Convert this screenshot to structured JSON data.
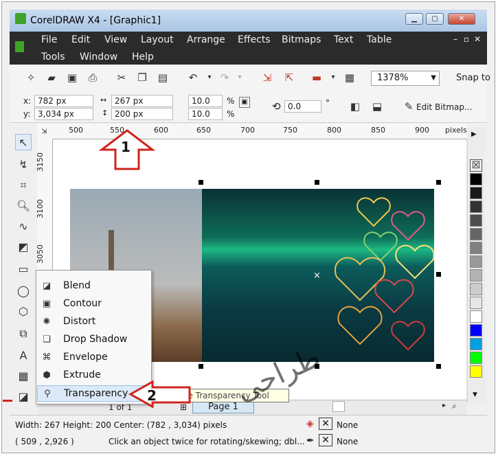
{
  "window": {
    "title": "CorelDRAW X4 - [Graphic1]"
  },
  "menu": {
    "row1": [
      "File",
      "Edit",
      "View",
      "Layout",
      "Arrange",
      "Effects",
      "Bitmaps",
      "Text",
      "Table"
    ],
    "row2": [
      "Tools",
      "Window",
      "Help"
    ],
    "mdi_controls": [
      "–",
      "▫",
      "✕"
    ]
  },
  "toolbar": {
    "zoom": "1378%",
    "snap_label": "Snap to"
  },
  "propbar": {
    "x_label": "x:",
    "x_value": "782 px",
    "y_label": "y:",
    "y_value": "3,034 px",
    "width_value": "267 px",
    "height_value": "200 px",
    "scale_x": "10.0",
    "scale_y": "10.0",
    "percent": "%",
    "rotation": "0.0",
    "degree": "°",
    "edit_bitmap": "Edit Bitmap..."
  },
  "ruler": {
    "h_ticks": [
      "500",
      "550",
      "600",
      "650",
      "700",
      "750",
      "800",
      "850",
      "900",
      "pixels"
    ],
    "v_ticks": [
      "3150",
      "3100",
      "3050"
    ]
  },
  "flyout": {
    "items": [
      {
        "label": "Blend",
        "icon": "blend-icon"
      },
      {
        "label": "Contour",
        "icon": "contour-icon"
      },
      {
        "label": "Distort",
        "icon": "distort-icon"
      },
      {
        "label": "Drop Shadow",
        "icon": "drop-shadow-icon"
      },
      {
        "label": "Envelope",
        "icon": "envelope-icon"
      },
      {
        "label": "Extrude",
        "icon": "extrude-icon"
      },
      {
        "label": "Transparency",
        "icon": "transparency-icon"
      }
    ]
  },
  "tooltip": "ive Transparency Tool",
  "page_nav": {
    "count": "1 of 1",
    "page_tab": "Page 1"
  },
  "status": {
    "line1": "Width: 267   Height: 200   Center: (782  , 3,034) pixels",
    "line2_coords": "( 509   , 2,926 )",
    "line2_msg": "Click an object twice for rotating/skewing; dbl...",
    "fill": "None",
    "outline": "None"
  },
  "callouts": {
    "one": "1",
    "two": "2"
  },
  "colors": {
    "palette": [
      "#000000",
      "#1a1a1a",
      "#333333",
      "#4d4d4d",
      "#666666",
      "#808080",
      "#999999",
      "#b3b3b3",
      "#cccccc",
      "#e6e6e6",
      "#ffffff",
      "#0000ff",
      "#00a0e0",
      "#00ff00",
      "#ffff00"
    ],
    "callout_red": "#d0241c"
  },
  "watermark": "طراحی"
}
